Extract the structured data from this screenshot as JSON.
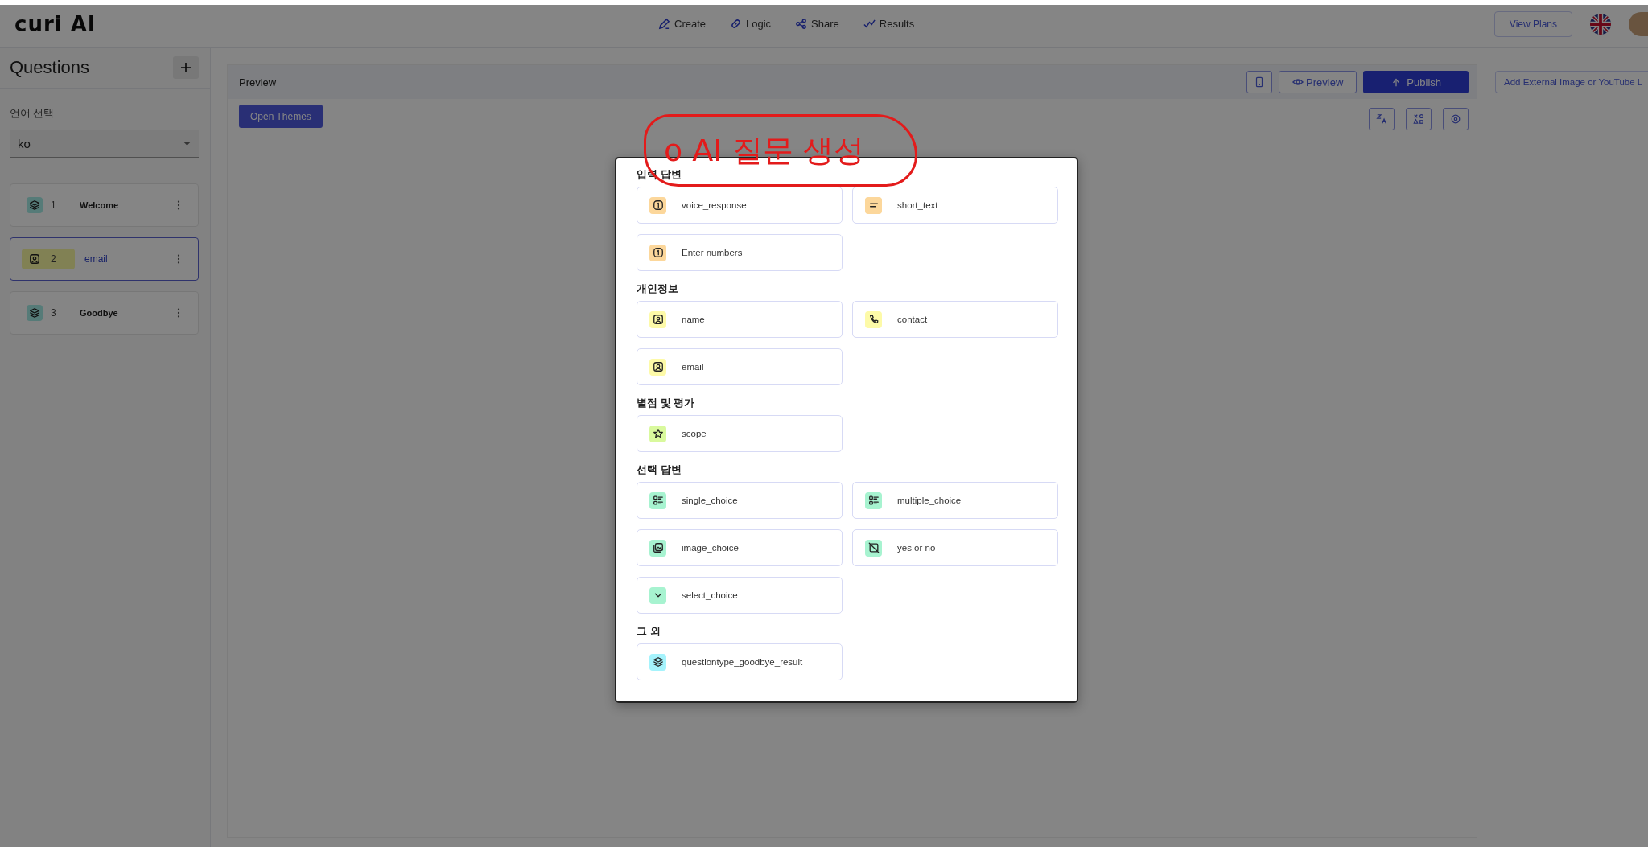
{
  "app": {
    "logo": "curi AI"
  },
  "nav": [
    {
      "label": "Create",
      "kind": "pen"
    },
    {
      "label": "Logic",
      "kind": "link"
    },
    {
      "label": "Share",
      "kind": "share"
    },
    {
      "label": "Results",
      "kind": "chart"
    }
  ],
  "top_actions": {
    "plans_button": "View Plans"
  },
  "sidebar": {
    "title": "Questions",
    "language_label": "언어 선택",
    "language_select": {
      "value": "ko"
    },
    "items": [
      {
        "number": "1",
        "label": "Welcome",
        "kind": "layers",
        "selected": false
      },
      {
        "number": "2",
        "label": "email",
        "kind": "user",
        "selected": true
      },
      {
        "number": "3",
        "label": "Goodbye",
        "kind": "layers",
        "selected": false
      }
    ]
  },
  "preview": {
    "title": "Preview",
    "preview_button": "Preview",
    "publish_button": "Publish",
    "themes_button": "Open Themes"
  },
  "media_panel": {
    "button": "Add External Image or YouTube L"
  },
  "annotation": {
    "text": "o AI 질문 생성"
  },
  "dialog": {
    "sections": [
      {
        "title": "입력 답변",
        "options": [
          {
            "label": "voice_response",
            "kind": "number",
            "color": "#fcd79b"
          },
          {
            "label": "short_text",
            "kind": "lines",
            "color": "#fcd79b"
          },
          {
            "label": "Enter numbers",
            "kind": "number",
            "color": "#fcd79b"
          }
        ]
      },
      {
        "title": "개인정보",
        "options": [
          {
            "label": "name",
            "kind": "user",
            "color": "#fdfaa8"
          },
          {
            "label": "contact",
            "kind": "phone",
            "color": "#fdfaa8"
          },
          {
            "label": "email",
            "kind": "user",
            "color": "#fdfaa8"
          }
        ]
      },
      {
        "title": "별점 및 평가",
        "options": [
          {
            "label": "scope",
            "kind": "star",
            "color": "#d9f99d"
          }
        ]
      },
      {
        "title": "선택 답변",
        "options": [
          {
            "label": "single_choice",
            "kind": "list",
            "color": "#a7f3d0"
          },
          {
            "label": "multiple_choice",
            "kind": "list",
            "color": "#a7f3d0"
          },
          {
            "label": "image_choice",
            "kind": "image",
            "color": "#a7f3d0"
          },
          {
            "label": "yes or no",
            "kind": "slash",
            "color": "#a7f3d0"
          },
          {
            "label": "select_choice",
            "kind": "chevron",
            "color": "#a7f3d0"
          }
        ]
      },
      {
        "title": "그 외",
        "options": [
          {
            "label": "questiontype_goodbye_result",
            "kind": "layers",
            "color": "#a5f3fc"
          }
        ]
      }
    ]
  }
}
